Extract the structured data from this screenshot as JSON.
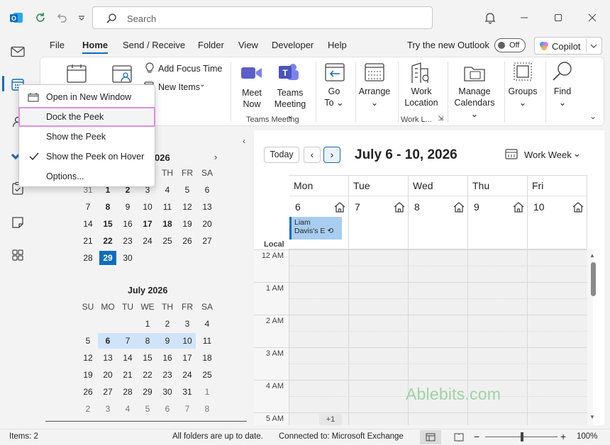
{
  "search": {
    "placeholder": "Search"
  },
  "tabs": [
    "File",
    "Home",
    "Send / Receive",
    "Folder",
    "View",
    "Developer",
    "Help"
  ],
  "header_right": {
    "try_new": "Try the new Outlook",
    "toggle": "Off",
    "copilot": "Copilot"
  },
  "ribbon": {
    "new_items_a": "Add Focus Time",
    "new_items_b": "New Items",
    "meet_now": [
      "Meet",
      "Now"
    ],
    "teams_meeting": [
      "Teams",
      "Meeting"
    ],
    "teams_group": "Teams Meeting",
    "go_to": [
      "Go",
      "To"
    ],
    "arrange": "Arrange",
    "work_location": [
      "Work",
      "Location"
    ],
    "work_group": "Work L...",
    "manage": [
      "Manage",
      "Calendars"
    ],
    "groups": "Groups",
    "find": "Find"
  },
  "context_menu": {
    "items": [
      "Open in New Window",
      "Dock the Peek",
      "Show the Peek",
      "Show the Peek on Hover",
      "Options..."
    ],
    "checked": "Show the Peek on Hover",
    "highlighted": "Dock the Peek"
  },
  "mini_cal_june": {
    "title_partial": "026",
    "weekday_partial": [
      "TH",
      "FR",
      "SA"
    ],
    "rows": [
      [
        "31",
        "1",
        "2",
        "3",
        "4",
        "5",
        "6"
      ],
      [
        "7",
        "8",
        "9",
        "10",
        "11",
        "12",
        "13"
      ],
      [
        "14",
        "15",
        "16",
        "17",
        "18",
        "19",
        "20"
      ],
      [
        "21",
        "22",
        "23",
        "24",
        "25",
        "26",
        "27"
      ],
      [
        "28",
        "29",
        "30"
      ]
    ]
  },
  "mini_cal_july": {
    "title": "July 2026",
    "weekdays": [
      "SU",
      "MO",
      "TU",
      "WE",
      "TH",
      "FR",
      "SA"
    ],
    "rows": [
      [
        "",
        "",
        "",
        "1",
        "2",
        "3",
        "4"
      ],
      [
        "5",
        "6",
        "7",
        "8",
        "9",
        "10",
        "11"
      ],
      [
        "12",
        "13",
        "14",
        "15",
        "16",
        "17",
        "18"
      ],
      [
        "19",
        "20",
        "21",
        "22",
        "23",
        "24",
        "25"
      ],
      [
        "26",
        "27",
        "28",
        "29",
        "30",
        "31",
        "1"
      ],
      [
        "2",
        "3",
        "4",
        "5",
        "6",
        "7",
        "8"
      ]
    ]
  },
  "calendar": {
    "today_btn": "Today",
    "range_title": "July 6 - 10, 2026",
    "view": "Work Week",
    "days": [
      {
        "name": "Mon",
        "num": "6"
      },
      {
        "name": "Tue",
        "num": "7"
      },
      {
        "name": "Wed",
        "num": "8"
      },
      {
        "name": "Thu",
        "num": "9"
      },
      {
        "name": "Fri",
        "num": "10"
      }
    ],
    "event": [
      "Liam",
      "Davis's E"
    ],
    "local": "Local",
    "hours": [
      "12 AM",
      "1 AM",
      "2 AM",
      "3 AM",
      "4 AM",
      "5 AM"
    ],
    "more": "+1",
    "watermark": "Ablebits.com"
  },
  "status": {
    "items": "Items: 2",
    "sync": "All folders are up to date.",
    "connection": "Connected to: Microsoft Exchange",
    "zoom": "100%"
  },
  "colors": {
    "accent": "#0f6cbd",
    "selected_day": "#0f6cbd",
    "week_highlight": "#cfe4fa",
    "event_bg": "#a9cdf0"
  }
}
